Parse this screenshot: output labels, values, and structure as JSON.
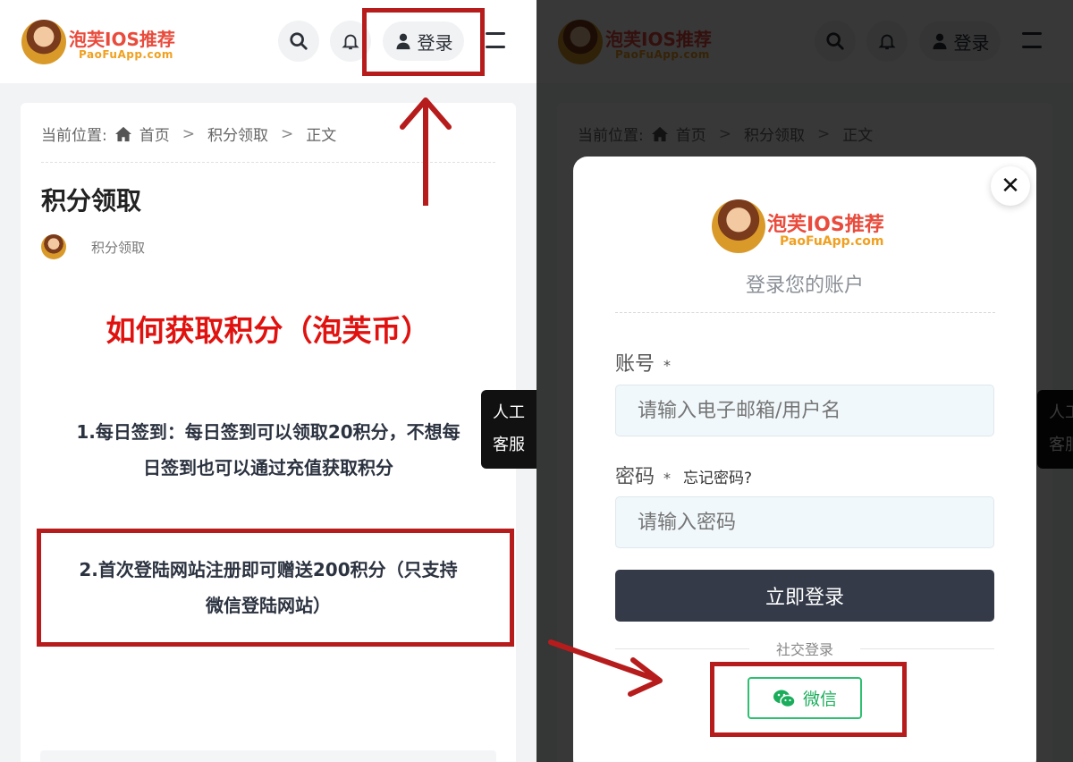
{
  "site": {
    "brand": "泡芙IOS推荐",
    "domain": "PaoFuApp.com"
  },
  "header": {
    "login_label": "登录"
  },
  "breadcrumb": {
    "prefix": "当前位置:",
    "items": [
      "首页",
      "积分领取",
      "正文"
    ],
    "separator": ">"
  },
  "post": {
    "title": "积分领取",
    "category": "积分领取",
    "headline": "如何获取积分（泡芙币）",
    "para1_line1": "1.每日签到：每日签到可以领取20积分，不想每",
    "para1_line2": "日签到也可以通过充值获取积分",
    "para2_line1": "2.首次登陆网站注册即可赠送200积分（只支持",
    "para2_line2": "微信登陆网站）"
  },
  "customer_service": {
    "line1": "人工",
    "line2": "客服"
  },
  "login_modal": {
    "subtitle": "登录您的账户",
    "account_label": "账号",
    "required_mark": "*",
    "account_placeholder": "请输入电子邮箱/用户名",
    "password_label": "密码",
    "forgot_label": "忘记密码?",
    "password_placeholder": "请输入密码",
    "submit_label": "立即登录",
    "social_label": "社交登录",
    "wechat_label": "微信"
  },
  "colors": {
    "annotation_red": "#b71c1c",
    "wechat_green": "#1aad5b",
    "headline_red": "#e0120f",
    "submit_dark": "#343a48"
  },
  "icons": [
    "search-icon",
    "bell-icon",
    "user-icon",
    "menu-icon",
    "home-icon",
    "close-icon",
    "wechat-icon",
    "arrow-up-icon",
    "arrow-down-right-icon"
  ]
}
